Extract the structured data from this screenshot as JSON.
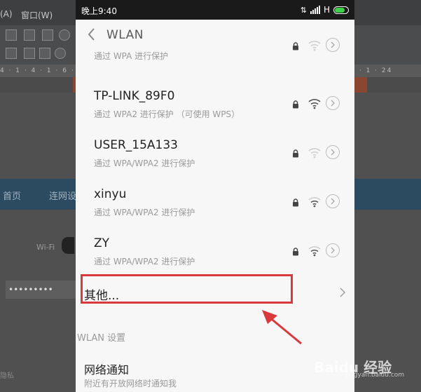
{
  "desktop": {
    "menu_a": "(A)",
    "menu_window": "窗口(W)",
    "ruler_text": "4 · 1 · 4 · 1 · 6 · 1 · 8 · 1 · 10 · 1 · 12 · 1 · 14 · 1 · 16 · 1 · 18 · 1 · 20 · 1 · 22 · 1 · 24",
    "nav_home": "首页",
    "nav_connect": "连网设",
    "wifi_label": "Wi-Fi",
    "password_mask": "•••••••••",
    "bottom_label": "隐私"
  },
  "statusbar": {
    "time": "晚上9:40",
    "network_type": "H",
    "battery_color": "#3bd14a"
  },
  "header": {
    "title": "WLAN",
    "back_icon": "chevron-left-icon"
  },
  "networks": [
    {
      "name": "",
      "security": "通过 WPA 进行保护"
    },
    {
      "name": "TP-LINK_89F0",
      "security": "通过 WPA2 进行保护 （可使用 WPS）"
    },
    {
      "name": "USER_15A133",
      "security": "通过 WPA/WPA2 进行保护"
    },
    {
      "name": "xinyu",
      "security": "通过 WPA/WPA2 进行保护"
    },
    {
      "name": "ZY",
      "security": "通过 WPA/WPA2 进行保护"
    }
  ],
  "other": {
    "label": "其他..."
  },
  "section": {
    "label": "WLAN 设置"
  },
  "notify": {
    "title": "网络通知",
    "subtitle": "附近有开放网络时通知我"
  },
  "annotation": {
    "highlight_color": "#d9383c"
  },
  "watermark": {
    "text": "Baidu 经验",
    "sub": "jingyan.baidu.com"
  }
}
